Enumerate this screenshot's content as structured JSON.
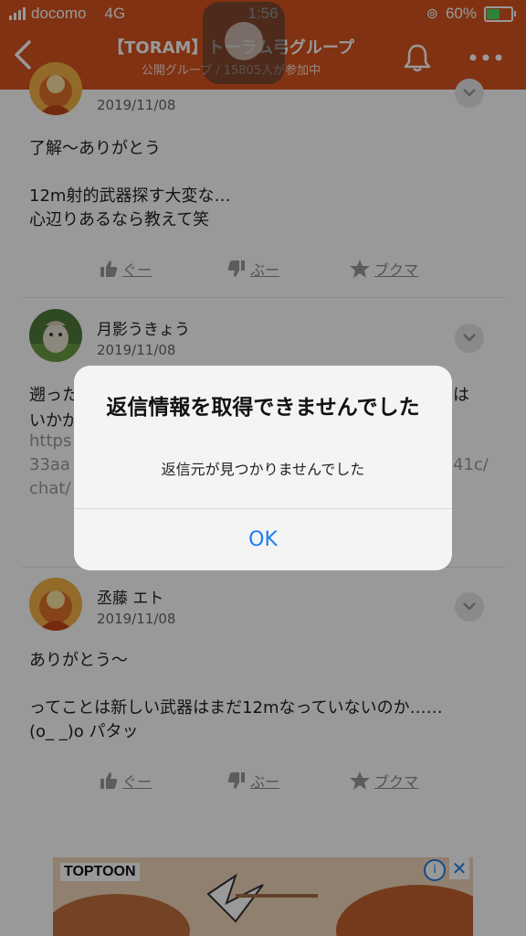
{
  "status_bar": {
    "carrier": "docomo",
    "network": "4G",
    "time": "1:56",
    "battery": "60%",
    "battery_level": 0.6,
    "battery_color": "#4cd964"
  },
  "header": {
    "title": "【TORAM】トーラム弓グループ",
    "subtitle": "公開グループ / 15805人が参加中",
    "background": "#d5541e",
    "icons": [
      "back-arrow-icon",
      "bell-icon",
      "more-icon"
    ]
  },
  "posts": [
    {
      "name": "",
      "date": "2019/11/08",
      "body": "了解〜ありがとう\n\n12m射的武器探す大変な…\n心辺りあるなら教えて笑",
      "actions": [
        "ぐー",
        "ぶー",
        "ブクマ"
      ]
    },
    {
      "name": "月影うきょう",
      "date": "2019/11/08",
      "body_line1": "遡った",
      "body_line1_end": "は",
      "body_line2": "いかが",
      "link_line1": "https",
      "link_line2_start": "33aa",
      "link_line2_end": "41c/",
      "link_line3": "chat/"
    },
    {
      "name": "丞藤 エト",
      "date": "2019/11/08",
      "body": "ありがとう〜\n\nってことは新しい武器はまだ12mなっていないのか……\n(o_ _)o パタッ",
      "actions": [
        "ぐー",
        "ぶー",
        "ブクマ"
      ]
    }
  ],
  "ad": {
    "brand": "TOPTOON",
    "info": "i",
    "close": "✕"
  },
  "alert": {
    "title": "返信情報を取得できませんでした",
    "message": "返信元が見つかりませんでした",
    "ok_label": "OK",
    "ok_color": "#1a7ef2"
  }
}
